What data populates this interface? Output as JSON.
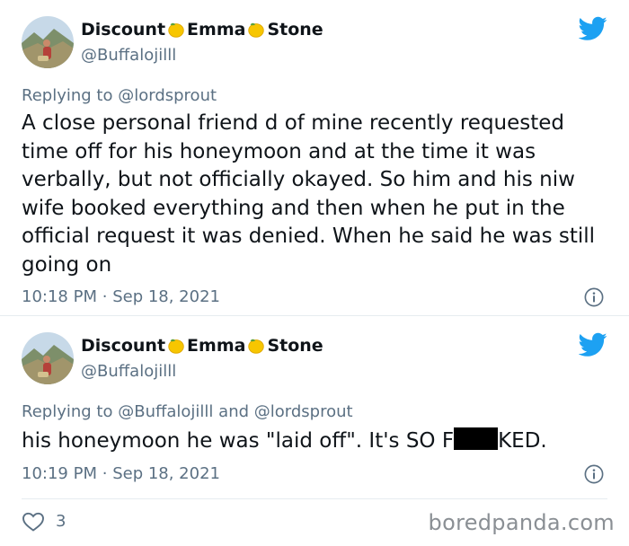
{
  "tweets": [
    {
      "display_name_parts": [
        "Discount",
        "Emma",
        "Stone"
      ],
      "handle": "@Buffalojilll",
      "replying_prefix": "Replying to",
      "replying_to": "@lordsprout",
      "text": "A close personal friend d of mine recently requested time off for his honeymoon and at the time it was verbally, but not officially okayed. So him and his niw wife booked everything and then when he put in the official request it was denied. When he said he was still going on",
      "time": "10:18 PM",
      "separator": "·",
      "date": "Sep 18, 2021"
    },
    {
      "display_name_parts": [
        "Discount",
        "Emma",
        "Stone"
      ],
      "handle": "@Buffalojilll",
      "replying_prefix": "Replying to",
      "replying_to": "@Buffalojilll",
      "replying_and": "and",
      "replying_to_2": "@lordsprout",
      "text_before": "his honeymoon he was \"laid off\". It's SO F",
      "text_after": "KED.",
      "time": "10:19 PM",
      "separator": "·",
      "date": "Sep 18, 2021"
    }
  ],
  "likes": "3",
  "watermark": "boredpanda.com",
  "icons": {
    "bird": "twitter-bird-icon",
    "lemon": "lemon-emoji-icon",
    "info": "info-icon",
    "heart": "heart-icon"
  },
  "colors": {
    "twitter_blue": "#1da1f2",
    "secondary_text": "#5b7083",
    "divider": "#e6ecf0",
    "lemon": "#f7c600"
  }
}
